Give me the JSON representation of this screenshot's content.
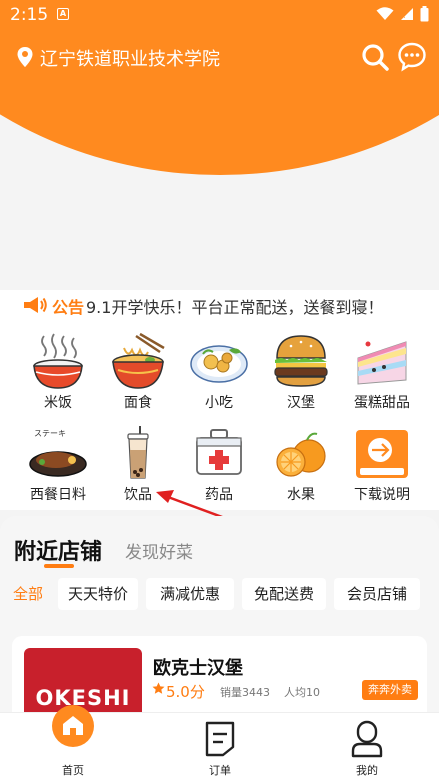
{
  "status_bar": {
    "time": "2:15"
  },
  "header": {
    "location": "辽宁铁道职业技术学院"
  },
  "notice": {
    "label": "公告",
    "text": "9.1开学快乐！平台正常配送，送餐到寝！"
  },
  "categories": [
    {
      "label": "米饭",
      "icon": "rice-bowl-icon"
    },
    {
      "label": "面食",
      "icon": "noodle-bowl-icon"
    },
    {
      "label": "小吃",
      "icon": "snack-plate-icon"
    },
    {
      "label": "汉堡",
      "icon": "burger-icon"
    },
    {
      "label": "蛋糕甜品",
      "icon": "cake-icon"
    },
    {
      "label": "西餐日料",
      "icon": "steak-icon",
      "icon_text": "ステーキ"
    },
    {
      "label": "饮品",
      "icon": "drink-cup-icon"
    },
    {
      "label": "药品",
      "icon": "medicine-box-icon"
    },
    {
      "label": "水果",
      "icon": "orange-fruit-icon"
    },
    {
      "label": "下载说明",
      "icon": "delivery-download-icon"
    }
  ],
  "nearby": {
    "tab_active": "附近店铺",
    "tab_other": "发现好菜",
    "filters": [
      "全部",
      "天天特价",
      "满减优惠",
      "免配送费",
      "会员店铺"
    ],
    "store": {
      "name": "欧克士汉堡",
      "logo_text": "OKESHI",
      "rating": "5.0分",
      "sales": "销量3443",
      "avg": "人均10",
      "badge": "奔奔外卖"
    }
  },
  "bottom_nav": [
    {
      "label": "首页"
    },
    {
      "label": "订单"
    },
    {
      "label": "我的"
    }
  ],
  "colors": {
    "accent": "#ff8a1f",
    "accent_text": "#ff7d12",
    "arrow": "#e02020"
  }
}
